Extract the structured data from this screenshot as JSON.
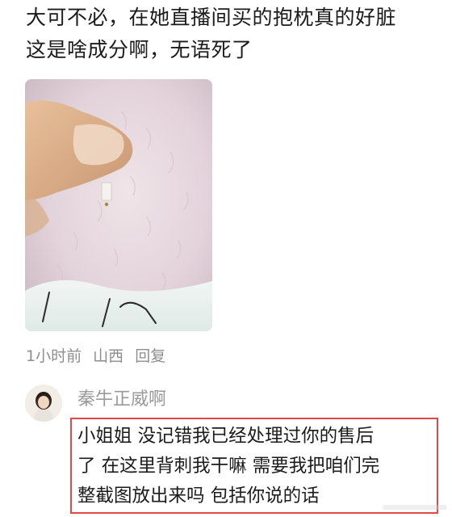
{
  "comment": {
    "lines": [
      "大可不必，在她直播间买的抱枕真的好脏",
      "这是啥成分啊，无语死了"
    ],
    "photo_icon": "comment-photo-image"
  },
  "meta": {
    "time": "1小时前",
    "location": "山西",
    "reply_label": "回复"
  },
  "reply": {
    "author": "秦牛正威啊",
    "avatar_icon": "user-avatar-icon",
    "lines": [
      "小姐姐 没记错我已经处理过你的售后",
      "了 在这里背刺我干嘛 需要我把咱们完",
      "整截图放出来吗 包括你说的话"
    ]
  },
  "colors": {
    "highlight_border": "#e04a45",
    "meta_text": "#8e8e8e",
    "author_text": "#9a9a9a",
    "body_text": "#1b1b1b"
  }
}
